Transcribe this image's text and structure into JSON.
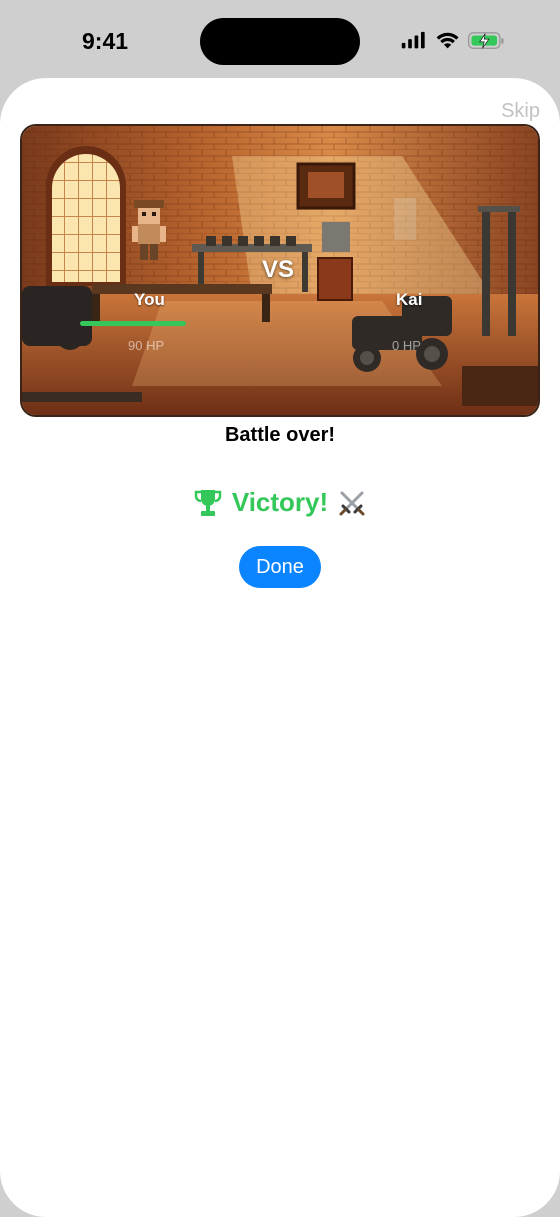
{
  "status_bar": {
    "time": "9:41",
    "icons": [
      "signal-icon",
      "wifi-icon",
      "battery-charging-icon"
    ],
    "battery_color": "#34c759"
  },
  "header": {
    "skip_label": "Skip"
  },
  "battle": {
    "vs_label": "VS",
    "player": {
      "name": "You",
      "hp_label": "90 HP",
      "hp_fraction": 1.0,
      "bar_color": "#35c759"
    },
    "opponent": {
      "name": "Kai",
      "hp_label": "0 HP",
      "hp_fraction": 0
    }
  },
  "status_text": "Battle over!",
  "result": {
    "icon": "trophy-icon",
    "text": "Victory!",
    "trailing_icon": "crossed-swords-icon",
    "color": "#34c759"
  },
  "actions": {
    "done_label": "Done",
    "accent": "#0a84ff"
  }
}
